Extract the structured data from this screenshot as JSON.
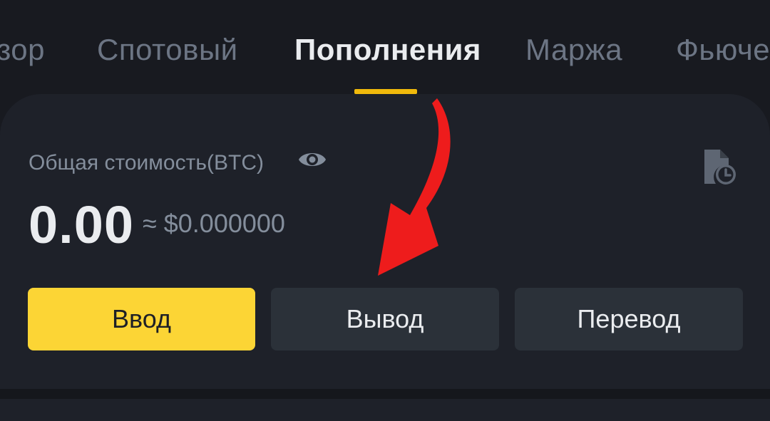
{
  "tabs": [
    {
      "label": "зор",
      "active": false
    },
    {
      "label": "Спотовый",
      "active": false
    },
    {
      "label": "Пополнения",
      "active": true
    },
    {
      "label": "Маржа",
      "active": false
    },
    {
      "label": "Фьюче",
      "active": false
    }
  ],
  "balance": {
    "label": "Общая стоимость(BTC)",
    "value": "0.00",
    "usd": "≈ $0.000000",
    "visibility_icon": "eye-icon",
    "history_icon": "history-icon"
  },
  "actions": {
    "deposit_label": "Ввод",
    "withdraw_label": "Вывод",
    "transfer_label": "Перевод"
  },
  "colors": {
    "accent": "#f0b90b",
    "primary_button": "#fcd535",
    "annotation_arrow": "#ee1c1c",
    "background": "#181a20",
    "card": "#1e2129"
  }
}
